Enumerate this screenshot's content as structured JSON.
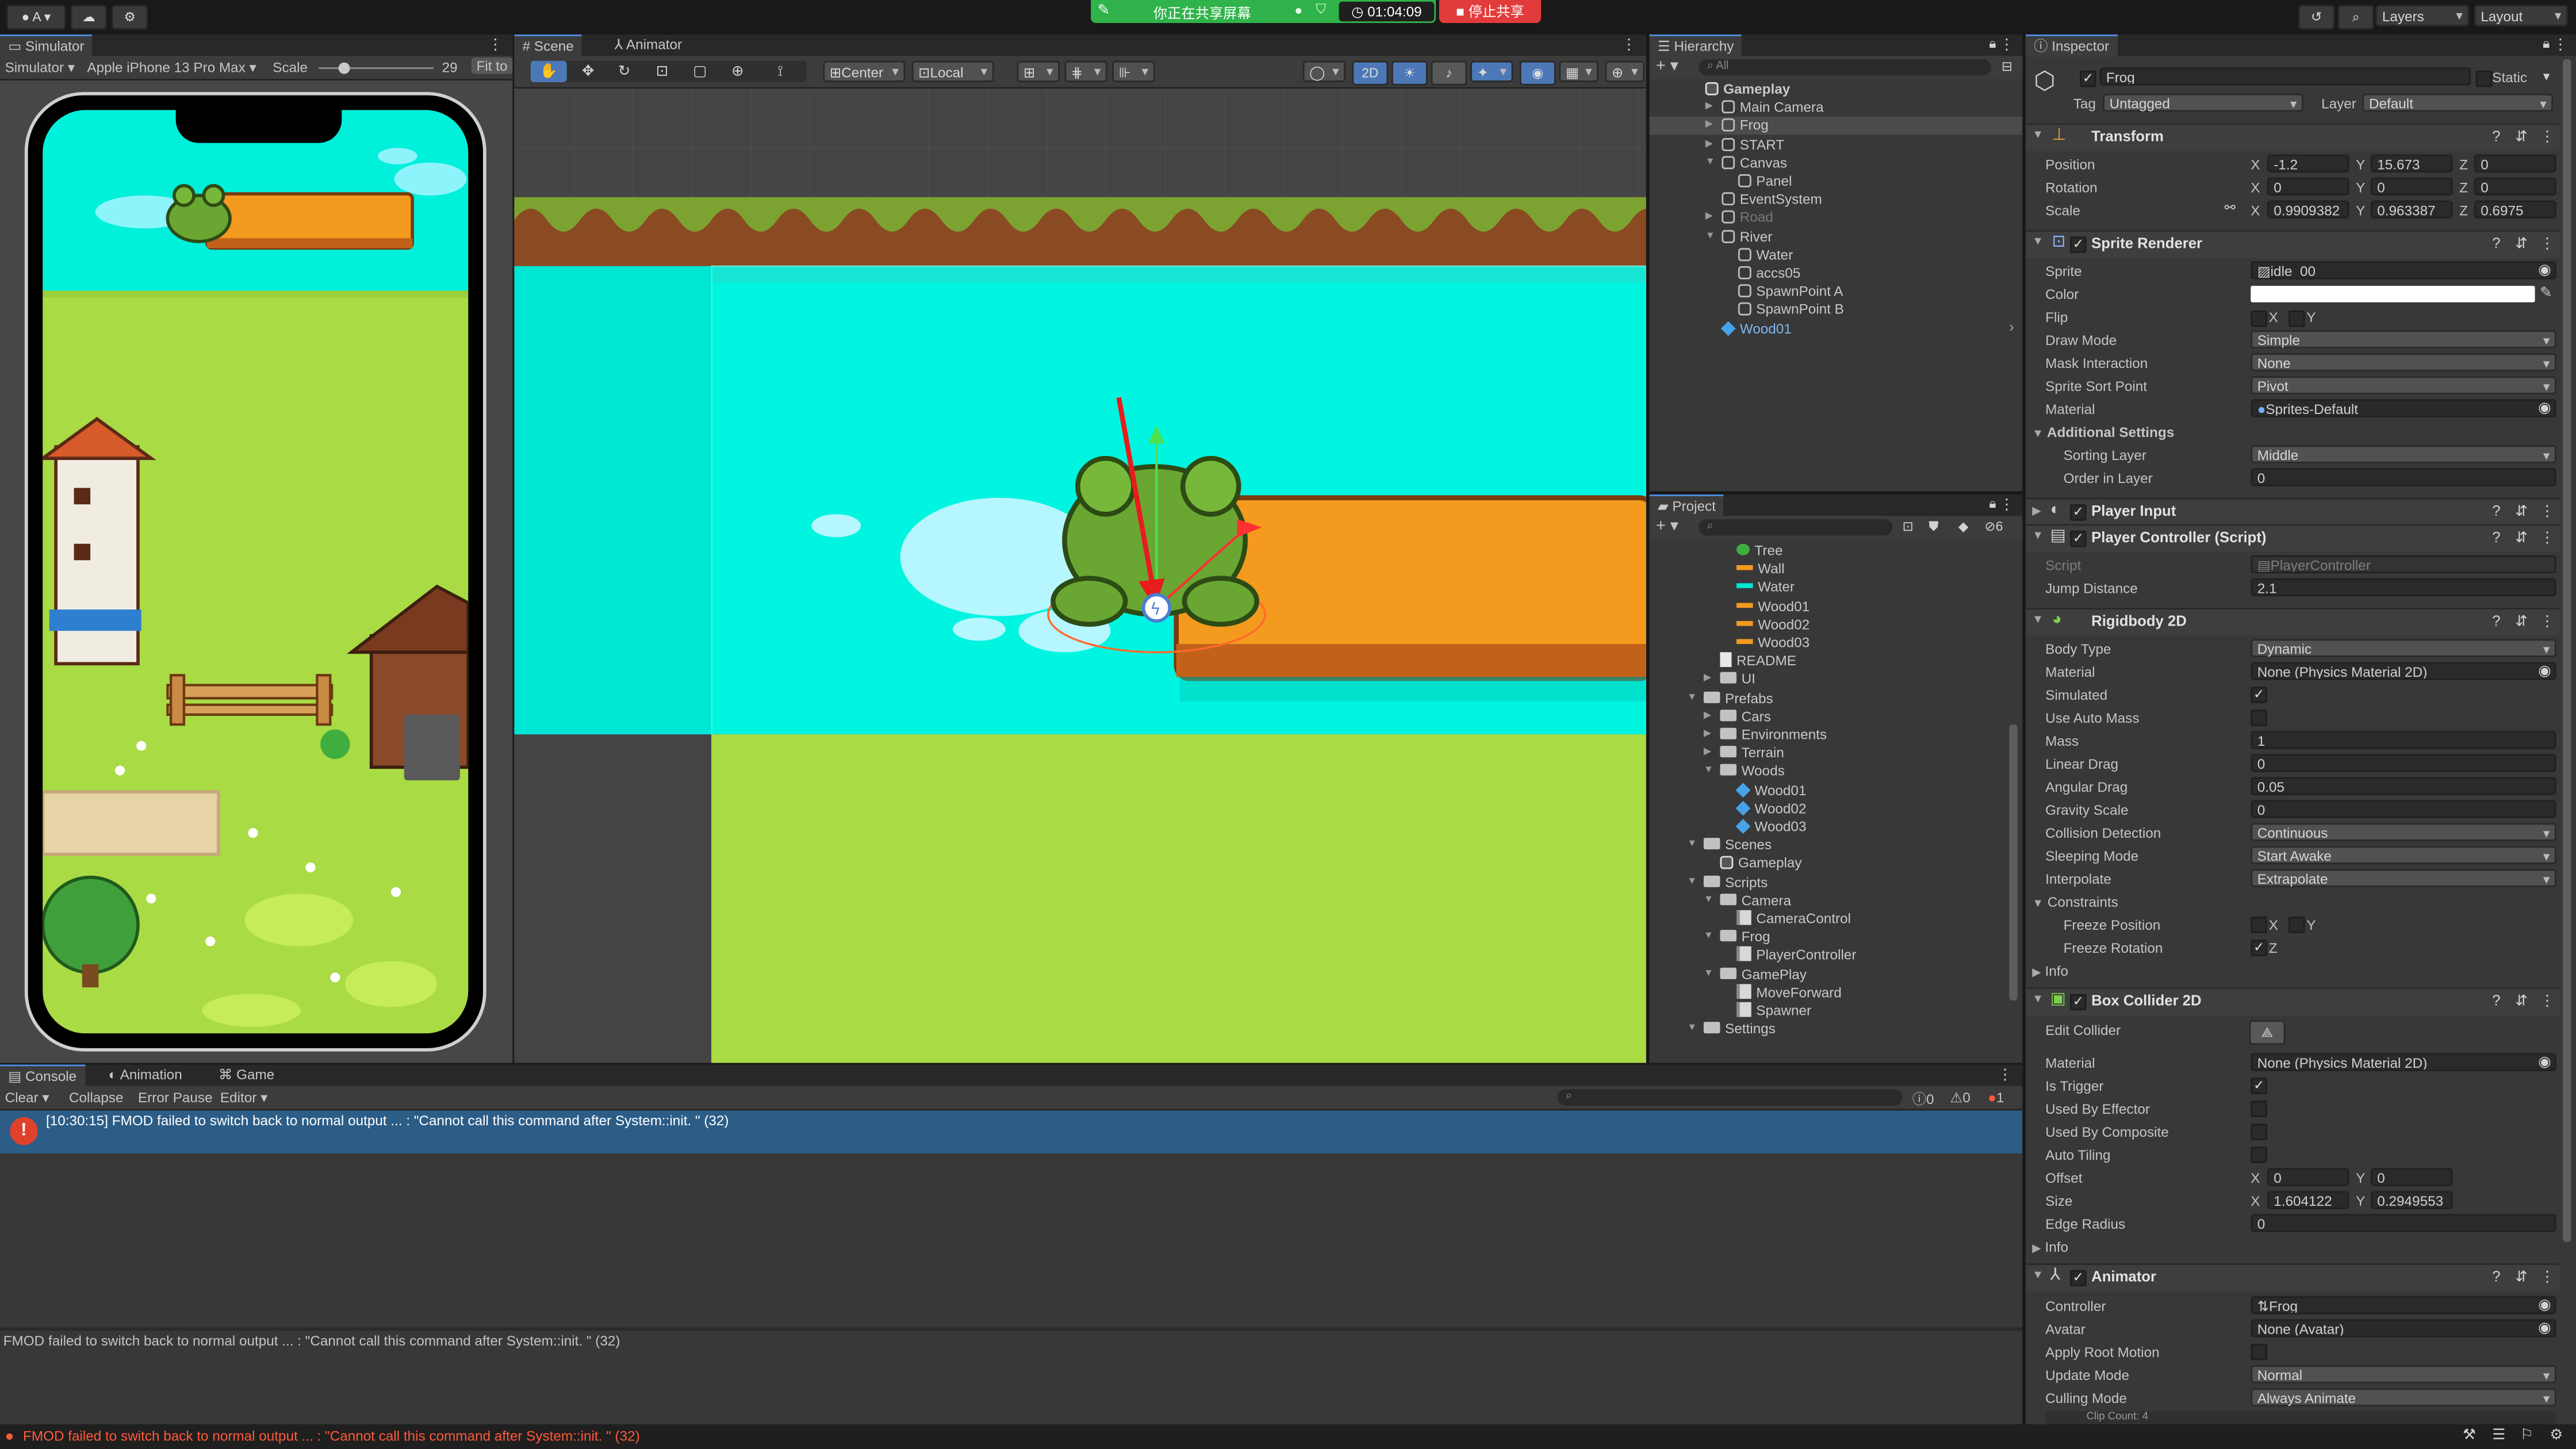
{
  "top_bar": {
    "account": "A",
    "sharing_text": "你正在共享屏幕",
    "timer": "01:04:09",
    "stop_sharing": "停止共享",
    "layers": "Layers",
    "layout": "Layout"
  },
  "simulator": {
    "tab": "Simulator",
    "mode": "Simulator",
    "device": "Apple iPhone 13 Pro Max",
    "scale_label": "Scale",
    "scale_value": "29",
    "fit": "Fit to"
  },
  "scene": {
    "tabs": [
      "Scene",
      "Animator"
    ],
    "center": "Center",
    "local": "Local",
    "mode_2d": "2D"
  },
  "hierarchy": {
    "tab": "Hierarchy",
    "search_placeholder": "All",
    "items": [
      {
        "label": "Gameplay",
        "depth": 0,
        "expanded": true,
        "icon": "unity-scene-icon",
        "bold": true
      },
      {
        "label": "Main Camera",
        "depth": 1,
        "arrow": "right",
        "icon": "cube-outline-icon"
      },
      {
        "label": "Frog",
        "depth": 1,
        "arrow": "right",
        "icon": "cube-outline-icon",
        "selected": true
      },
      {
        "label": "START",
        "depth": 1,
        "arrow": "right",
        "icon": "cube-outline-icon"
      },
      {
        "label": "Canvas",
        "depth": 1,
        "arrow": "down",
        "icon": "cube-outline-icon"
      },
      {
        "label": "Panel",
        "depth": 2,
        "icon": "cube-outline-icon"
      },
      {
        "label": "EventSystem",
        "depth": 1,
        "icon": "cube-outline-icon"
      },
      {
        "label": "Road",
        "depth": 1,
        "arrow": "right",
        "icon": "cube-outline-icon",
        "dim": true
      },
      {
        "label": "River",
        "depth": 1,
        "arrow": "down",
        "icon": "cube-outline-icon"
      },
      {
        "label": "Water",
        "depth": 2,
        "icon": "cube-outline-icon"
      },
      {
        "label": "accs05",
        "depth": 2,
        "icon": "cube-outline-icon"
      },
      {
        "label": "SpawnPoint A",
        "depth": 2,
        "icon": "cube-outline-icon"
      },
      {
        "label": "SpawnPoint B",
        "depth": 2,
        "icon": "cube-outline-icon"
      },
      {
        "label": "Wood01",
        "depth": 1,
        "icon": "prefab-cube-icon",
        "prefab": true
      }
    ]
  },
  "project": {
    "tab": "Project",
    "hidden_count": "6",
    "items": [
      {
        "label": "Tree",
        "depth": 2,
        "icon": "sprite-tree-icon"
      },
      {
        "label": "Wall",
        "depth": 2,
        "icon": "sprite-orange-icon"
      },
      {
        "label": "Water",
        "depth": 2,
        "icon": "sprite-cyan-icon"
      },
      {
        "label": "Wood01",
        "depth": 2,
        "icon": "sprite-orange-icon"
      },
      {
        "label": "Wood02",
        "depth": 2,
        "icon": "sprite-orange-icon"
      },
      {
        "label": "Wood03",
        "depth": 2,
        "icon": "sprite-orange-icon"
      },
      {
        "label": "README",
        "depth": 1,
        "icon": "document-icon"
      },
      {
        "label": "UI",
        "depth": 1,
        "icon": "folder-icon",
        "arrow": "right"
      },
      {
        "label": "Prefabs",
        "depth": 0,
        "icon": "folder-icon",
        "arrow": "down"
      },
      {
        "label": "Cars",
        "depth": 1,
        "icon": "folder-icon",
        "arrow": "right"
      },
      {
        "label": "Environments",
        "depth": 1,
        "icon": "folder-icon",
        "arrow": "right"
      },
      {
        "label": "Terrain",
        "depth": 1,
        "icon": "folder-icon",
        "arrow": "right"
      },
      {
        "label": "Woods",
        "depth": 1,
        "icon": "folder-icon",
        "arrow": "down"
      },
      {
        "label": "Wood01",
        "depth": 2,
        "icon": "prefab-cube-icon"
      },
      {
        "label": "Wood02",
        "depth": 2,
        "icon": "prefab-cube-icon"
      },
      {
        "label": "Wood03",
        "depth": 2,
        "icon": "prefab-cube-icon"
      },
      {
        "label": "Scenes",
        "depth": 0,
        "icon": "folder-icon",
        "arrow": "down"
      },
      {
        "label": "Gameplay",
        "depth": 1,
        "icon": "unity-scene-icon"
      },
      {
        "label": "Scripts",
        "depth": 0,
        "icon": "folder-icon",
        "arrow": "down"
      },
      {
        "label": "Camera",
        "depth": 1,
        "icon": "folder-icon",
        "arrow": "down"
      },
      {
        "label": "CameraControl",
        "depth": 2,
        "icon": "script-icon"
      },
      {
        "label": "Frog",
        "depth": 1,
        "icon": "folder-icon",
        "arrow": "down"
      },
      {
        "label": "PlayerController",
        "depth": 2,
        "icon": "script-icon"
      },
      {
        "label": "GamePlay",
        "depth": 1,
        "icon": "folder-icon",
        "arrow": "down"
      },
      {
        "label": "MoveForward",
        "depth": 2,
        "icon": "script-icon"
      },
      {
        "label": "Spawner",
        "depth": 2,
        "icon": "script-icon"
      },
      {
        "label": "Settings",
        "depth": 0,
        "icon": "folder-icon",
        "arrow": "down"
      }
    ]
  },
  "inspector": {
    "tab": "Inspector",
    "object_name": "Frog",
    "static_label": "Static",
    "tag_label": "Tag",
    "tag_value": "Untagged",
    "layer_label": "Layer",
    "layer_value": "Default",
    "transform": {
      "title": "Transform",
      "position_label": "Position",
      "pos_x": "-1.2",
      "pos_y": "15.673",
      "pos_z": "0",
      "rotation_label": "Rotation",
      "rot_x": "0",
      "rot_y": "0",
      "rot_z": "0",
      "scale_label": "Scale",
      "scale_x": "0.9909382",
      "scale_y": "0.963387",
      "scale_z": "0.6975"
    },
    "sprite_renderer": {
      "title": "Sprite Renderer",
      "sprite_label": "Sprite",
      "sprite_value": "idle_00",
      "color_label": "Color",
      "color_value": "#ffffff",
      "flip_label": "Flip",
      "flip_x": "X",
      "flip_y": "Y",
      "draw_mode_label": "Draw Mode",
      "draw_mode_value": "Simple",
      "mask_label": "Mask Interaction",
      "mask_value": "None",
      "sort_point_label": "Sprite Sort Point",
      "sort_point_value": "Pivot",
      "material_label": "Material",
      "material_value": "Sprites-Default",
      "additional_label": "Additional Settings",
      "sorting_layer_label": "Sorting Layer",
      "sorting_layer_value": "Middle",
      "order_label": "Order in Layer",
      "order_value": "0"
    },
    "player_input": {
      "title": "Player Input"
    },
    "player_controller": {
      "title": "Player Controller (Script)",
      "script_label": "Script",
      "script_value": "PlayerController",
      "jump_label": "Jump Distance",
      "jump_value": "2.1"
    },
    "rigidbody": {
      "title": "Rigidbody 2D",
      "body_type_label": "Body Type",
      "body_type_value": "Dynamic",
      "material_label": "Material",
      "material_value": "None (Physics Material 2D)",
      "simulated_label": "Simulated",
      "auto_mass_label": "Use Auto Mass",
      "mass_label": "Mass",
      "mass_value": "1",
      "linear_drag_label": "Linear Drag",
      "linear_drag_value": "0",
      "angular_drag_label": "Angular Drag",
      "angular_drag_value": "0.05",
      "gravity_label": "Gravity Scale",
      "gravity_value": "0",
      "collision_label": "Collision Detection",
      "collision_value": "Continuous",
      "sleeping_label": "Sleeping Mode",
      "sleeping_value": "Start Awake",
      "interpolate_label": "Interpolate",
      "interpolate_value": "Extrapolate",
      "constraints_label": "Constraints",
      "freeze_pos_label": "Freeze Position",
      "freeze_rot_label": "Freeze Rotation",
      "x": "X",
      "y": "Y",
      "z": "Z",
      "info_label": "Info"
    },
    "box_collider": {
      "title": "Box Collider 2D",
      "edit_label": "Edit Collider",
      "material_label": "Material",
      "material_value": "None (Physics Material 2D)",
      "trigger_label": "Is Trigger",
      "effector_label": "Used By Effector",
      "composite_label": "Used By Composite",
      "tiling_label": "Auto Tiling",
      "offset_label": "Offset",
      "offset_x": "0",
      "offset_y": "0",
      "size_label": "Size",
      "size_x": "1.604122",
      "size_y": "0.2949553",
      "edge_label": "Edge Radius",
      "edge_value": "0",
      "info_label": "Info"
    },
    "animator": {
      "title": "Animator",
      "controller_label": "Controller",
      "controller_value": "Frog",
      "avatar_label": "Avatar",
      "avatar_value": "None (Avatar)",
      "root_motion_label": "Apply Root Motion",
      "update_label": "Update Mode",
      "update_value": "Normal",
      "culling_label": "Culling Mode",
      "culling_value": "Always Animate",
      "clip_count": "Clip Count: 4"
    }
  },
  "console": {
    "tabs": [
      "Console",
      "Animation",
      "Game"
    ],
    "clear": "Clear",
    "collapse": "Collapse",
    "error_pause": "Error Pause",
    "editor": "Editor",
    "log_count": "0",
    "warn_count": "0",
    "error_count": "1",
    "entry": "[10:30:15] FMOD failed to switch back to normal output ... : \"Cannot call this command after System::init. \" (32)",
    "detail": "FMOD failed to switch back to normal output ... : \"Cannot call this command after System::init. \" (32)",
    "status": "FMOD failed to switch back to normal output ... : \"Cannot call this command after System::init. \" (32)"
  },
  "colors": {
    "accent": "#4d90e6",
    "error": "#e0412c",
    "share_green": "#2fb34a",
    "water": "#00f5e1",
    "grass": "#a9db44",
    "wood": "#f39a1f"
  }
}
